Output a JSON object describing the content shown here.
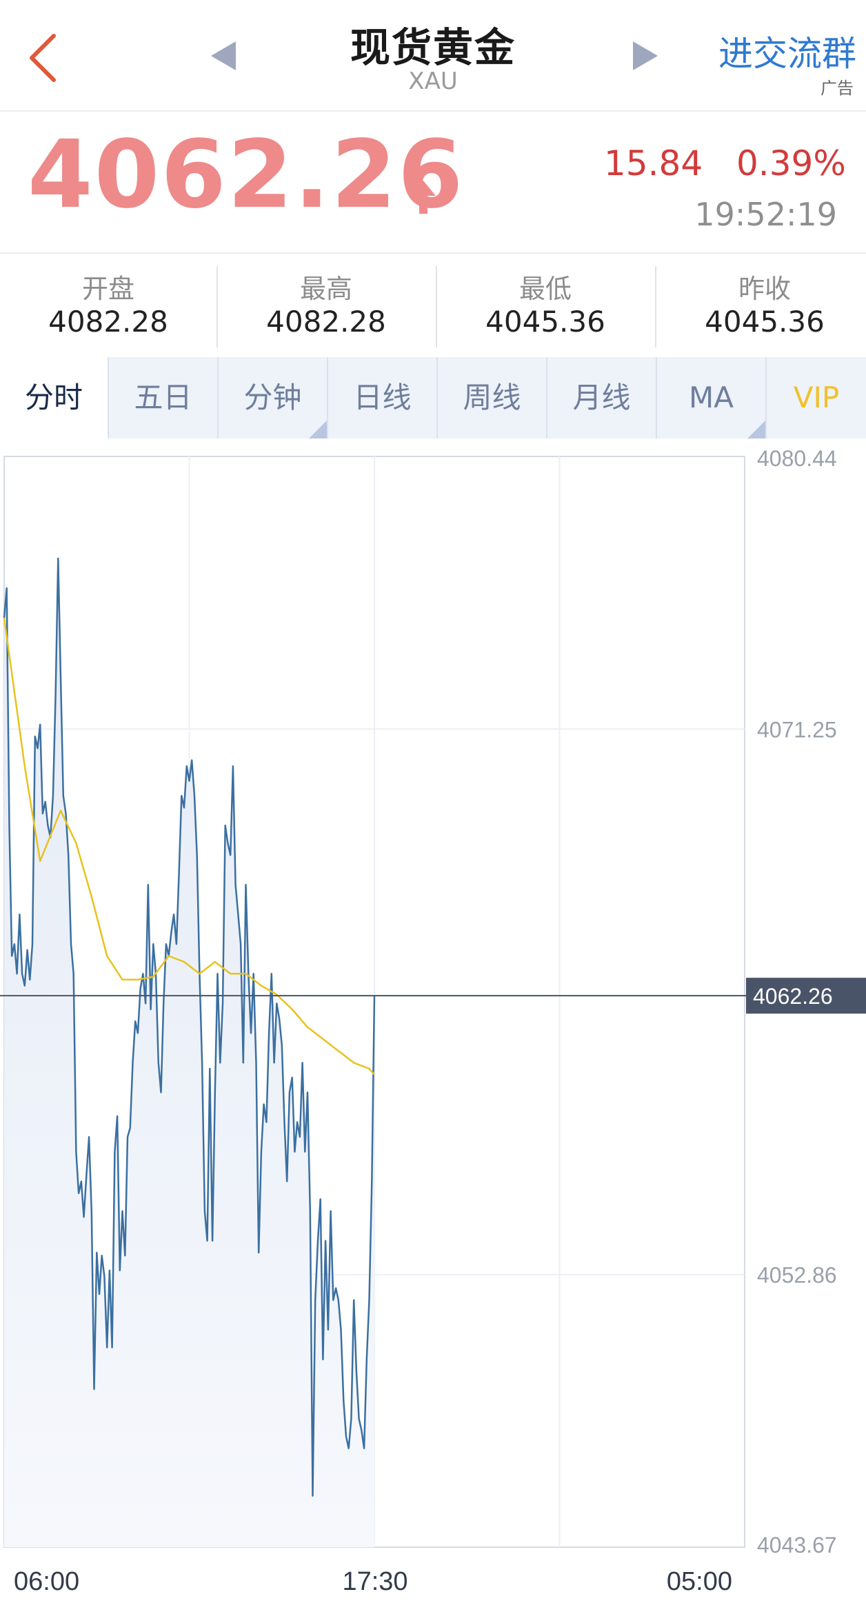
{
  "nav": {
    "title": "现货黄金",
    "symbol": "XAU",
    "join_group": "进交流群",
    "ad_label": "广告"
  },
  "quote": {
    "price": "4062.26",
    "change": "15.84",
    "change_pct": "0.39%",
    "time": "19:52:19"
  },
  "stats": [
    {
      "label": "开盘",
      "value": "4082.28"
    },
    {
      "label": "最高",
      "value": "4082.28"
    },
    {
      "label": "最低",
      "value": "4045.36"
    },
    {
      "label": "昨收",
      "value": "4045.36"
    }
  ],
  "tabs": [
    {
      "label": "分时",
      "active": true,
      "corner": false
    },
    {
      "label": "五日",
      "active": false,
      "corner": false
    },
    {
      "label": "分钟",
      "active": false,
      "corner": true
    },
    {
      "label": "日线",
      "active": false,
      "corner": false
    },
    {
      "label": "周线",
      "active": false,
      "corner": false
    },
    {
      "label": "月线",
      "active": false,
      "corner": false
    },
    {
      "label": "MA",
      "active": false,
      "corner": true
    },
    {
      "label": "VIP",
      "active": false,
      "corner": false
    }
  ],
  "colors": {
    "price": "#ee8a8a",
    "change": "#d23b3b",
    "price_line": "#3b6fa0",
    "average_line": "#e8c21e",
    "current_tag": "#4a5468",
    "link": "#2f7ad0"
  },
  "chart_data": {
    "type": "line",
    "ylim": [
      4043.67,
      4080.44
    ],
    "y_ticks": [
      "4080.44",
      "4071.25",
      "4062.26",
      "4052.86",
      "4043.67"
    ],
    "x_ticks": [
      "06:00",
      "17:30",
      "05:00"
    ],
    "current_price_label": "4062.26",
    "current_price": 4062.26,
    "series": [
      {
        "role": "price",
        "x": [
          0,
          1,
          2,
          3,
          4,
          5,
          6,
          7,
          8,
          9,
          10,
          11,
          12,
          13,
          14,
          15,
          16,
          17,
          18,
          19,
          20,
          21,
          22,
          23,
          24,
          25,
          26,
          27,
          28,
          29,
          30,
          31,
          32,
          33,
          34,
          35,
          36,
          37,
          38,
          39,
          40,
          41,
          42,
          43,
          44,
          45,
          46,
          47,
          48,
          49,
          50,
          51,
          52,
          53,
          54,
          55,
          56,
          57,
          58,
          59,
          60,
          61,
          62,
          63,
          64,
          65,
          66,
          67,
          68,
          69,
          70,
          71,
          72,
          73,
          74,
          75,
          76,
          77,
          78,
          79,
          80,
          81,
          82,
          83,
          84,
          85,
          86,
          87,
          88,
          89,
          90,
          91,
          92,
          93,
          94,
          95,
          96,
          97,
          98,
          99,
          100,
          101,
          102,
          103,
          104,
          105,
          106,
          107,
          108,
          109,
          110,
          111,
          112,
          113,
          114,
          115,
          116,
          117,
          118,
          119,
          120,
          121,
          122,
          123,
          124,
          125,
          126,
          127,
          128,
          129,
          130,
          131,
          132,
          133,
          134,
          135,
          136,
          137,
          138,
          139,
          140,
          141,
          142,
          143,
          144
        ],
        "values": [
          4075.0,
          4076.0,
          4068.0,
          4063.6,
          4064.0,
          4063.0,
          4065.0,
          4063.0,
          4062.6,
          4063.8,
          4062.8,
          4064.0,
          4071.0,
          4070.6,
          4071.4,
          4068.4,
          4068.8,
          4068.0,
          4067.6,
          4069.0,
          4072.4,
          4077.0,
          4073.0,
          4069.0,
          4068.4,
          4067.0,
          4064.0,
          4063.0,
          4057.0,
          4055.6,
          4056.0,
          4054.8,
          4056.2,
          4057.5,
          4055.0,
          4049.0,
          4053.6,
          4052.2,
          4053.5,
          4052.8,
          4050.4,
          4053.0,
          4050.4,
          4057.0,
          4058.2,
          4053.0,
          4055.0,
          4053.5,
          4057.5,
          4057.8,
          4060.0,
          4061.4,
          4061.0,
          4062.5,
          4063.0,
          4062.0,
          4066.0,
          4061.8,
          4064.0,
          4063.0,
          4060.0,
          4059.0,
          4062.0,
          4064.0,
          4063.6,
          4064.4,
          4065.0,
          4064.0,
          4066.4,
          4069.0,
          4068.6,
          4070.0,
          4069.5,
          4070.2,
          4069.0,
          4067.0,
          4063.0,
          4060.0,
          4055.0,
          4054.0,
          4059.8,
          4054.0,
          4059.0,
          4063.0,
          4060.0,
          4062.0,
          4068.0,
          4067.4,
          4067.0,
          4070.0,
          4066.0,
          4065.0,
          4064.0,
          4060.0,
          4066.0,
          4063.0,
          4061.0,
          4063.0,
          4060.0,
          4053.6,
          4057.0,
          4058.6,
          4058.0,
          4061.0,
          4063.0,
          4060.0,
          4062.0,
          4061.5,
          4060.6,
          4058.0,
          4056.0,
          4059.0,
          4059.5,
          4057.0,
          4058.0,
          4057.5,
          4060.0,
          4057.0,
          4059.0,
          4055.0,
          4045.4,
          4052.0,
          4054.0,
          4055.4,
          4050.0,
          4054.0,
          4051.0,
          4055.0,
          4052.0,
          4052.4,
          4052.0,
          4051.0,
          4048.6,
          4047.4,
          4047.0,
          4048.0,
          4052.0,
          4049.6,
          4048.0,
          4047.6,
          4047.0,
          4050.0,
          4052.0,
          4056.0,
          4062.26
        ]
      },
      {
        "role": "average",
        "x": [
          0,
          8,
          14,
          22,
          28,
          34,
          40,
          46,
          52,
          58,
          64,
          70,
          76,
          82,
          88,
          94,
          100,
          106,
          112,
          118,
          124,
          130,
          136,
          142,
          144
        ],
        "values": [
          4075.0,
          4070.0,
          4066.8,
          4068.5,
          4067.4,
          4065.6,
          4063.6,
          4062.8,
          4062.8,
          4062.9,
          4063.6,
          4063.4,
          4063.0,
          4063.4,
          4063.0,
          4063.0,
          4062.6,
          4062.3,
          4061.8,
          4061.2,
          4060.8,
          4060.4,
          4060.0,
          4059.8,
          4059.6
        ]
      }
    ],
    "grid": true
  }
}
